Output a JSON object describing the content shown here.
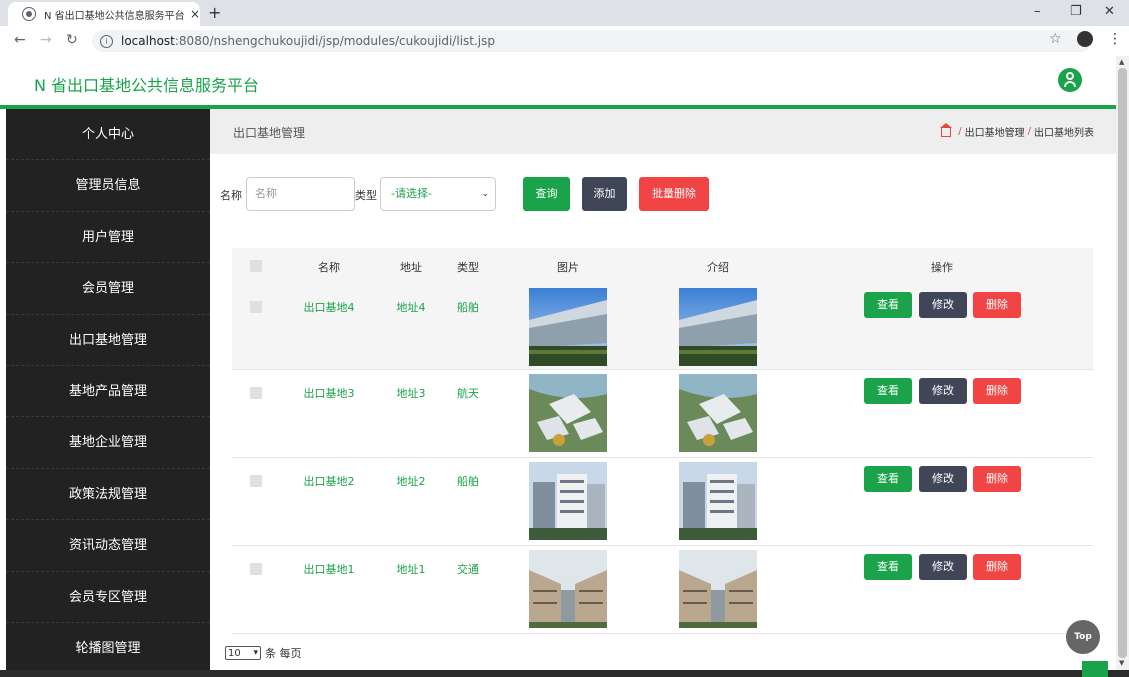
{
  "browser": {
    "tab_title": "N 省出口基地公共信息服务平台",
    "tab_close": "×",
    "new_tab": "+",
    "url_host": "localhost",
    "url_path": ":8080/nshengchukoujidi/jsp/modules/cukoujidi/list.jsp",
    "min": "–",
    "max": "❐",
    "close": "✕"
  },
  "header": {
    "site_title": "N 省出口基地公共信息服务平台"
  },
  "sidebar": {
    "items": [
      {
        "label": "个人中心"
      },
      {
        "label": "管理员信息"
      },
      {
        "label": "用户管理"
      },
      {
        "label": "会员管理"
      },
      {
        "label": "出口基地管理"
      },
      {
        "label": "基地产品管理"
      },
      {
        "label": "基地企业管理"
      },
      {
        "label": "政策法规管理"
      },
      {
        "label": "资讯动态管理"
      },
      {
        "label": "会员专区管理"
      },
      {
        "label": "轮播图管理"
      }
    ]
  },
  "breadcrumb": {
    "title": "出口基地管理",
    "sep": "/",
    "level1": "出口基地管理",
    "level2": "出口基地列表"
  },
  "search": {
    "name_label": "名称",
    "name_placeholder": "名称",
    "type_label": "类型",
    "type_selected": "-请选择-",
    "query_btn": "查询",
    "add_btn": "添加",
    "batch_delete_btn": "批量删除"
  },
  "table": {
    "headers": {
      "name": "名称",
      "address": "地址",
      "type": "类型",
      "image": "图片",
      "intro": "介绍",
      "actions": "操作"
    },
    "rows": [
      {
        "name": "出口基地4",
        "address": "地址4",
        "type": "船舶"
      },
      {
        "name": "出口基地3",
        "address": "地址3",
        "type": "航天"
      },
      {
        "name": "出口基地2",
        "address": "地址2",
        "type": "船舶"
      },
      {
        "name": "出口基地1",
        "address": "地址1",
        "type": "交通"
      }
    ],
    "view_btn": "查看",
    "edit_btn": "修改",
    "delete_btn": "删除"
  },
  "pager": {
    "page_size": "10",
    "suffix": "条 每页"
  },
  "top_btn": "Top",
  "colors": {
    "accent": "#1aa34a",
    "dark_btn": "#3f4657",
    "danger": "#f14545",
    "sidebar": "#222222"
  }
}
